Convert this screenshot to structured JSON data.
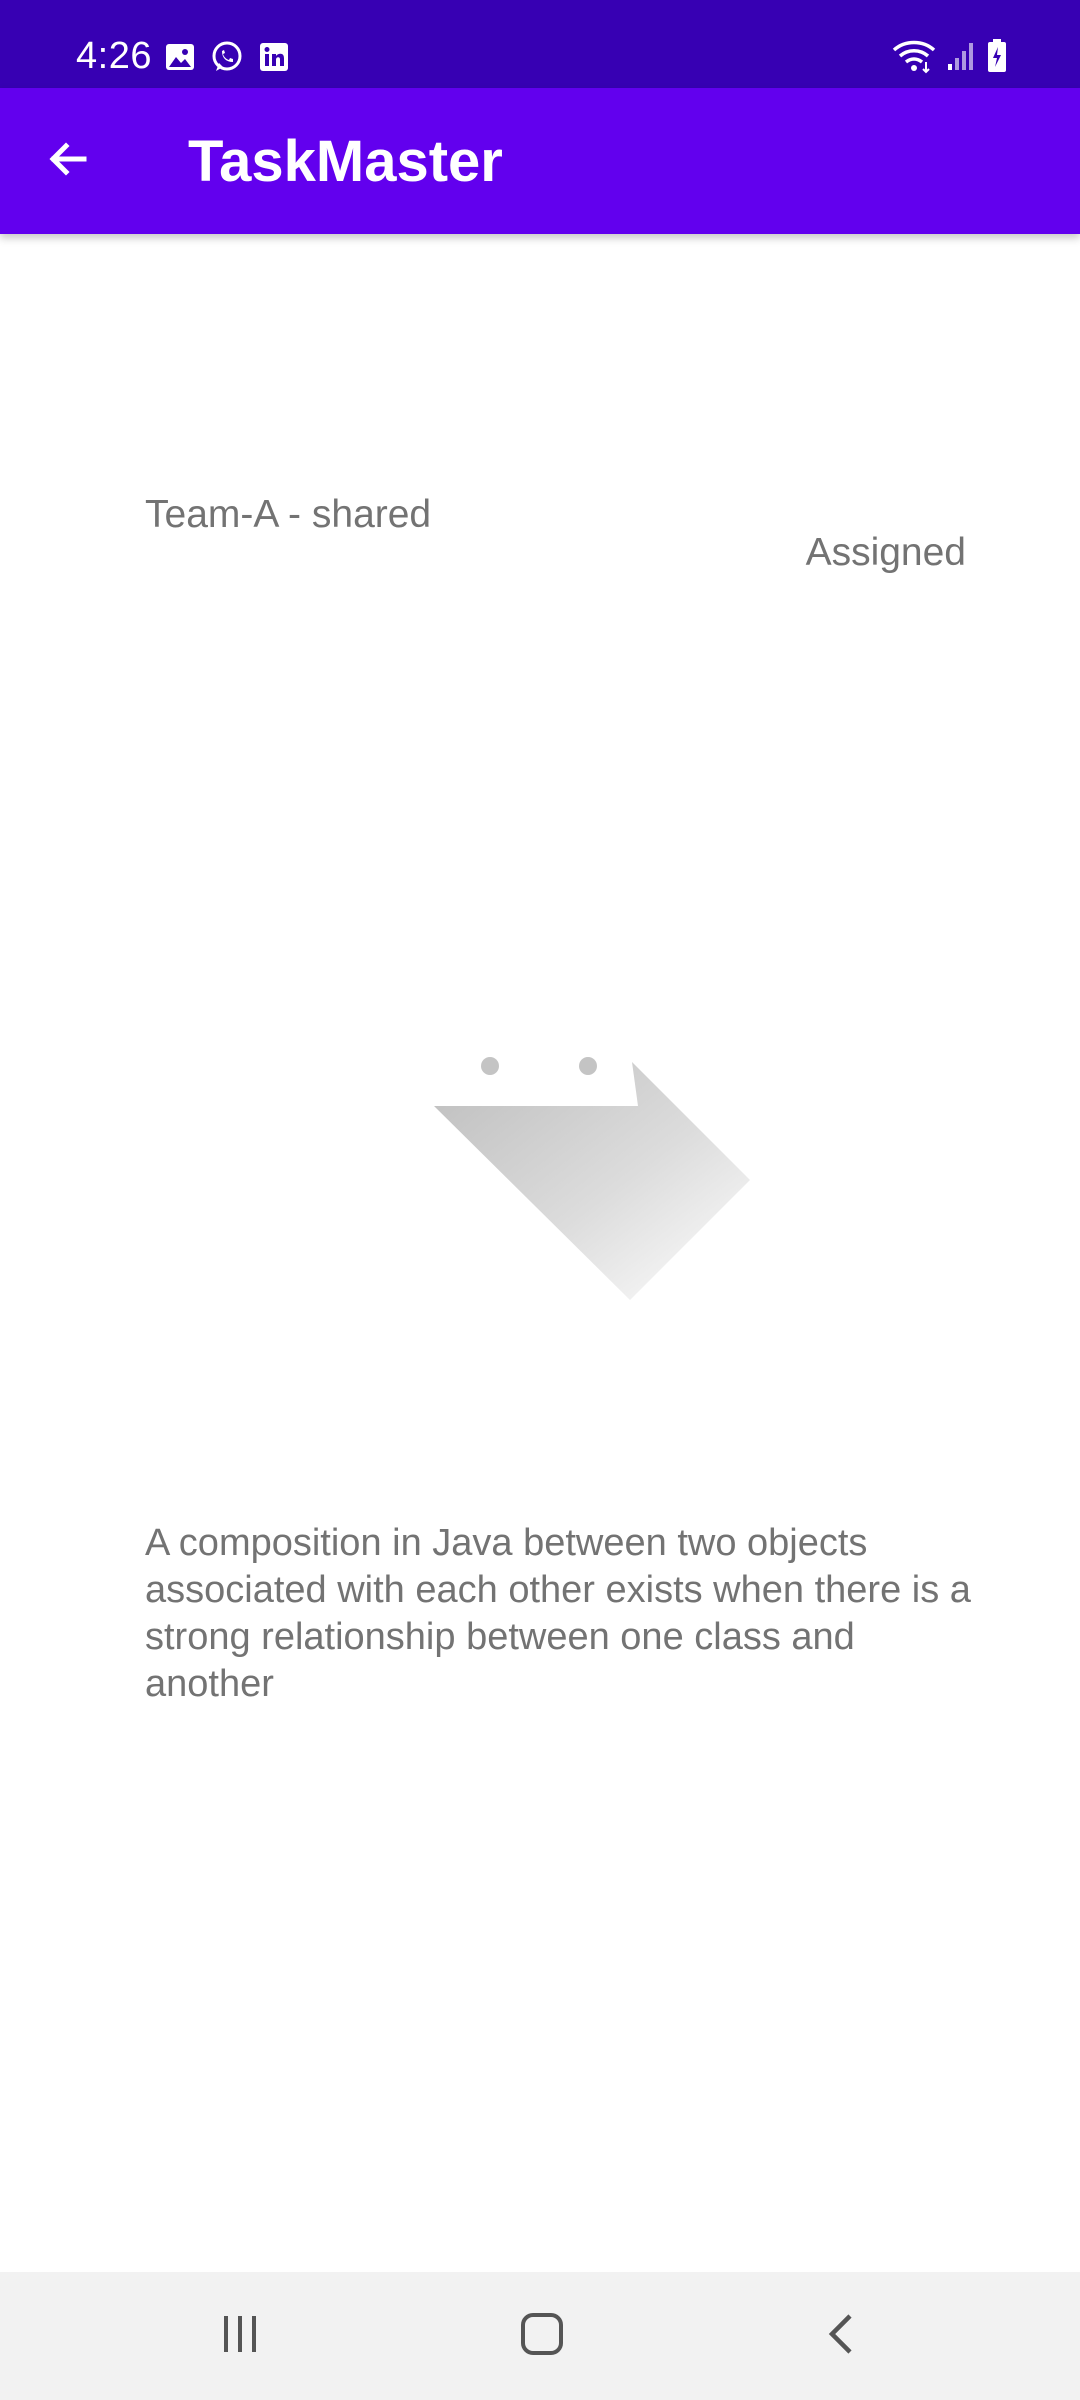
{
  "status_bar": {
    "time": "4:26",
    "left_icons": [
      "gallery-icon",
      "whatsapp-icon",
      "linkedin-icon"
    ],
    "right_icons": [
      "wifi-icon",
      "signal-icon",
      "battery-charging-icon"
    ],
    "background_color": "#3700b3"
  },
  "app_bar": {
    "title": "TaskMaster",
    "back_icon": "arrow-back-icon",
    "background_color": "#6200ee"
  },
  "task": {
    "team": "Team-A - shared",
    "state": "Assigned",
    "image_icon": "image-placeholder-icon",
    "description": "A composition in Java between two objects associated with each other exists when there is a strong relationship between one class and another"
  },
  "nav_bar": {
    "buttons": [
      "recent-apps-icon",
      "home-icon",
      "back-icon"
    ]
  }
}
